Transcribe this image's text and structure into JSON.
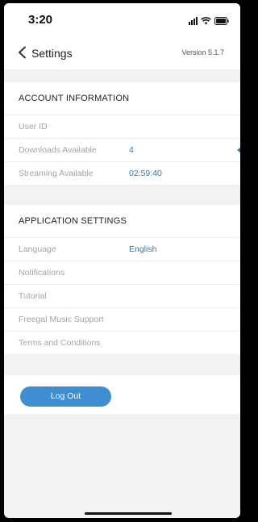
{
  "status_bar": {
    "time": "3:20"
  },
  "header": {
    "title": "Settings",
    "version": "Version 5.1.7"
  },
  "account": {
    "heading": "ACCOUNT INFORMATION",
    "rows": [
      {
        "label": "User ID",
        "value": ""
      },
      {
        "label": "Downloads Available",
        "value": "4"
      },
      {
        "label": "Streaming Available",
        "value": "02:59:40"
      }
    ]
  },
  "application": {
    "heading": "APPLICATION SETTINGS",
    "rows": [
      {
        "label": "Language",
        "value": "English"
      },
      {
        "label": "Notifications"
      },
      {
        "label": "Tutorial"
      },
      {
        "label": "Freegal Music Support"
      },
      {
        "label": "Terms and Conditions"
      }
    ]
  },
  "actions": {
    "logout_label": "Log Out"
  },
  "colors": {
    "accent": "#3f8ed2",
    "value_text": "#2b79b8",
    "muted_label": "#a4a4a4"
  },
  "icons": [
    "signal-icon",
    "wifi-icon",
    "battery-icon",
    "chevron-left-icon"
  ]
}
